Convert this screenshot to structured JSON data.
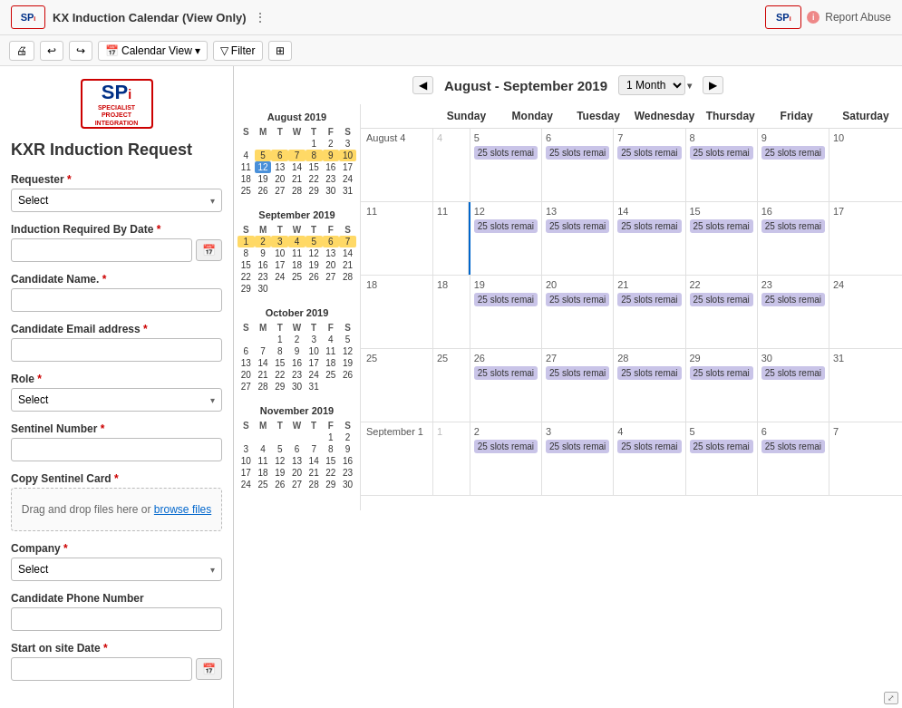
{
  "topBar": {
    "title": "KX Induction Calendar (View Only)",
    "reportAbuse": "Report Abuse"
  },
  "toolbar": {
    "calendarView": "Calendar View",
    "filter": "Filter"
  },
  "calHeader": {
    "title": "August - September 2019",
    "monthOption": "1 Month"
  },
  "dayHeaders": [
    "Sunday",
    "Monday",
    "Tuesday",
    "Wednesday",
    "Thursday",
    "Friday",
    "Saturday"
  ],
  "form": {
    "title": "KXR Induction Request",
    "requester": {
      "label": "Requester",
      "placeholder": "Select"
    },
    "inductionDate": {
      "label": "Induction Required By Date"
    },
    "candidateName": {
      "label": "Candidate Name.",
      "placeholder": ""
    },
    "candidateEmail": {
      "label": "Candidate Email address",
      "placeholder": ""
    },
    "role": {
      "label": "Role",
      "placeholder": "Select"
    },
    "sentinelNumber": {
      "label": "Sentinel Number",
      "placeholder": ""
    },
    "copySentinelCard": {
      "label": "Copy Sentinel Card",
      "dropText": "Drag and drop files here or ",
      "browseText": "browse files"
    },
    "company": {
      "label": "Company",
      "placeholder": "Select"
    },
    "candidatePhone": {
      "label": "Candidate Phone Number",
      "placeholder": ""
    },
    "startOnSite": {
      "label": "Start on site Date"
    }
  },
  "miniCals": [
    {
      "title": "August 2019",
      "headers": [
        "S",
        "M",
        "T",
        "W",
        "T",
        "F",
        "S"
      ],
      "weeks": [
        [
          null,
          null,
          null,
          null,
          1,
          2,
          3
        ],
        [
          4,
          5,
          6,
          7,
          8,
          9,
          10
        ],
        [
          11,
          12,
          13,
          14,
          15,
          16,
          17
        ],
        [
          18,
          19,
          20,
          21,
          22,
          23,
          24
        ],
        [
          25,
          26,
          27,
          28,
          29,
          30,
          31
        ]
      ],
      "todayCell": [
        2,
        1
      ],
      "highlights": [
        [
          1,
          1
        ],
        [
          1,
          2
        ],
        [
          1,
          3
        ],
        [
          1,
          4
        ],
        [
          1,
          5
        ],
        [
          1,
          6
        ]
      ],
      "orangeHighlights": []
    },
    {
      "title": "September 2019",
      "headers": [
        "S",
        "M",
        "T",
        "W",
        "T",
        "F",
        "S"
      ],
      "weeks": [
        [
          1,
          2,
          3,
          4,
          5,
          6,
          7
        ],
        [
          8,
          9,
          10,
          11,
          12,
          13,
          14
        ],
        [
          15,
          16,
          17,
          18,
          19,
          20,
          21
        ],
        [
          22,
          23,
          24,
          25,
          26,
          27,
          28
        ],
        [
          29,
          30,
          null,
          null,
          null,
          null,
          null
        ]
      ],
      "highlights": [
        [
          0,
          0
        ],
        [
          0,
          1
        ],
        [
          0,
          2
        ],
        [
          0,
          3
        ],
        [
          0,
          4
        ],
        [
          0,
          5
        ],
        [
          0,
          6
        ]
      ],
      "orangeHighlights": []
    },
    {
      "title": "October 2019",
      "headers": [
        "S",
        "M",
        "T",
        "W",
        "T",
        "F",
        "S"
      ],
      "weeks": [
        [
          null,
          null,
          1,
          2,
          3,
          4,
          5
        ],
        [
          6,
          7,
          8,
          9,
          10,
          11,
          12
        ],
        [
          13,
          14,
          15,
          16,
          17,
          18,
          19
        ],
        [
          20,
          21,
          22,
          23,
          24,
          25,
          26
        ],
        [
          27,
          28,
          29,
          30,
          31,
          null,
          null
        ]
      ],
      "highlights": [],
      "orangeHighlights": []
    },
    {
      "title": "November 2019",
      "headers": [
        "S",
        "M",
        "T",
        "W",
        "T",
        "F",
        "S"
      ],
      "weeks": [
        [
          null,
          null,
          null,
          null,
          null,
          1,
          2
        ],
        [
          3,
          4,
          5,
          6,
          7,
          8,
          9
        ],
        [
          10,
          11,
          12,
          13,
          14,
          15,
          16
        ],
        [
          17,
          18,
          19,
          20,
          21,
          22,
          23
        ],
        [
          24,
          25,
          26,
          27,
          28,
          29,
          30
        ]
      ],
      "highlights": [],
      "orangeHighlights": []
    }
  ],
  "calWeeks": [
    {
      "weekLabel": "August 4",
      "days": [
        {
          "num": "4",
          "otherMonth": true,
          "slots": []
        },
        {
          "num": "5",
          "slots": [
            "25 slots remai"
          ]
        },
        {
          "num": "6",
          "slots": [
            "25 slots remai"
          ]
        },
        {
          "num": "7",
          "slots": [
            "25 slots remai"
          ]
        },
        {
          "num": "8",
          "slots": [
            "25 slots remai"
          ]
        },
        {
          "num": "9",
          "slots": [
            "25 slots remai"
          ]
        },
        {
          "num": "10",
          "slots": []
        }
      ]
    },
    {
      "weekLabel": "11",
      "days": [
        {
          "num": "11",
          "slots": []
        },
        {
          "num": "12",
          "slots": [
            "25 slots remai"
          ],
          "today": true
        },
        {
          "num": "13",
          "slots": [
            "25 slots remai"
          ]
        },
        {
          "num": "14",
          "slots": [
            "25 slots remai"
          ]
        },
        {
          "num": "15",
          "slots": [
            "25 slots remai"
          ]
        },
        {
          "num": "16",
          "slots": [
            "25 slots remai"
          ]
        },
        {
          "num": "17",
          "slots": []
        }
      ]
    },
    {
      "weekLabel": "18",
      "days": [
        {
          "num": "18",
          "slots": []
        },
        {
          "num": "19",
          "slots": [
            "25 slots remai"
          ]
        },
        {
          "num": "20",
          "slots": [
            "25 slots remai"
          ]
        },
        {
          "num": "21",
          "slots": [
            "25 slots remai"
          ]
        },
        {
          "num": "22",
          "slots": [
            "25 slots remai"
          ]
        },
        {
          "num": "23",
          "slots": [
            "25 slots remai"
          ]
        },
        {
          "num": "24",
          "slots": []
        }
      ]
    },
    {
      "weekLabel": "25",
      "days": [
        {
          "num": "25",
          "slots": []
        },
        {
          "num": "26",
          "slots": [
            "25 slots remai"
          ]
        },
        {
          "num": "27",
          "slots": [
            "25 slots remai"
          ]
        },
        {
          "num": "28",
          "slots": [
            "25 slots remai"
          ]
        },
        {
          "num": "29",
          "slots": [
            "25 slots remai"
          ]
        },
        {
          "num": "30",
          "slots": [
            "25 slots remai"
          ]
        },
        {
          "num": "31",
          "slots": []
        }
      ]
    },
    {
      "weekLabel": "September 1",
      "days": [
        {
          "num": "1",
          "otherMonth": true,
          "slots": []
        },
        {
          "num": "2",
          "slots": [
            "25 slots remai"
          ]
        },
        {
          "num": "3",
          "slots": [
            "25 slots remai"
          ]
        },
        {
          "num": "4",
          "slots": [
            "25 slots remai"
          ]
        },
        {
          "num": "5",
          "slots": [
            "25 slots remai"
          ]
        },
        {
          "num": "6",
          "slots": [
            "25 slots remai"
          ]
        },
        {
          "num": "7",
          "slots": []
        }
      ]
    }
  ]
}
